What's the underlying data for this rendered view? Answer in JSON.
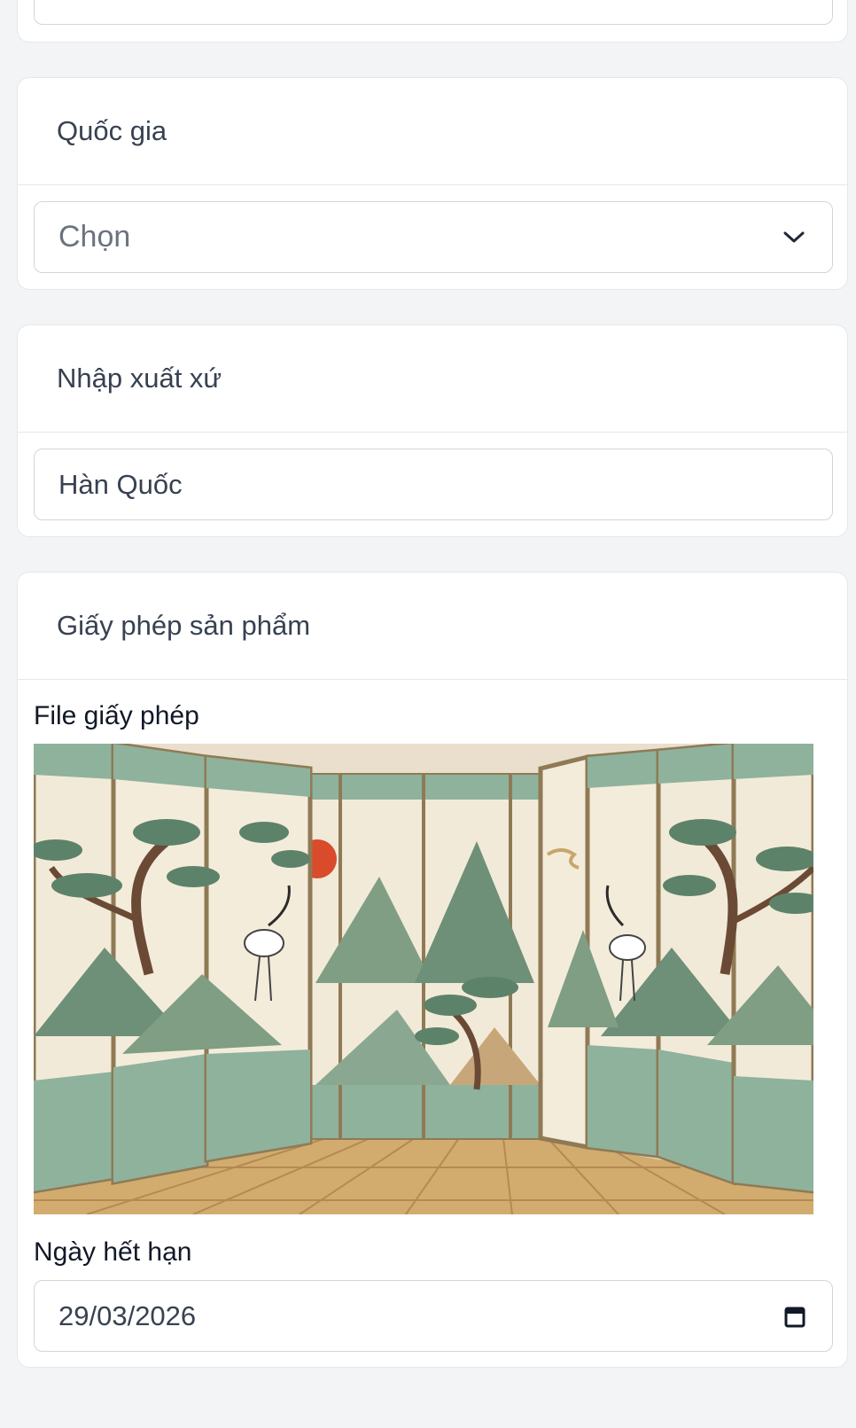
{
  "country": {
    "label": "Quốc gia",
    "select_value": "Chọn"
  },
  "origin": {
    "label": "Nhập xuất xứ",
    "value": "Hàn Quốc"
  },
  "license": {
    "label": "Giấy phép sản phẩm",
    "file_label": "File giấy phép",
    "image_description_icon": "image-icon",
    "expiry_label": "Ngày hết hạn",
    "expiry_value": "29/03/2026"
  },
  "icons": {
    "chevron": "chevron-down-icon",
    "calendar": "calendar-icon"
  },
  "colors": {
    "card_bg": "#ffffff",
    "page_bg": "#f3f4f6",
    "border": "#e5e7eb",
    "text": "#374151"
  }
}
